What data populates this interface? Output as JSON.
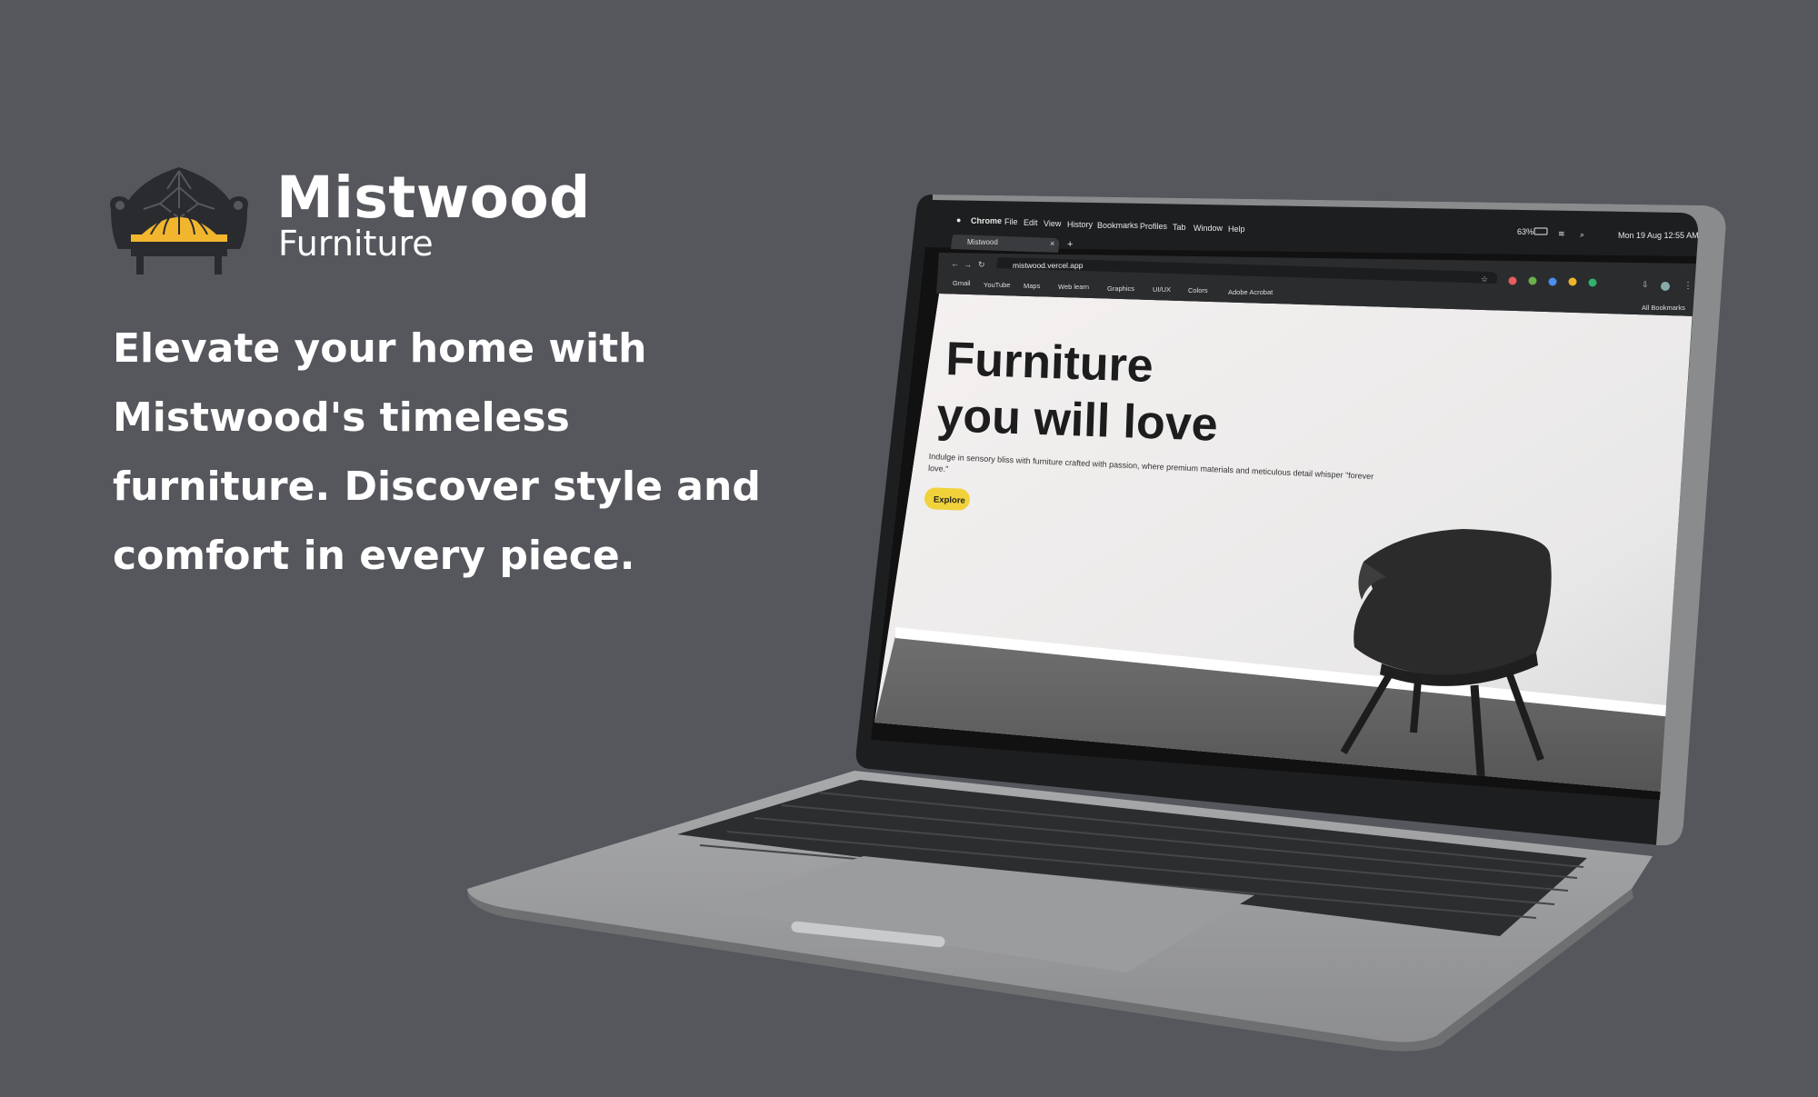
{
  "brand": {
    "name": "Mistwood",
    "subtitle": "Furniture"
  },
  "tagline": "Elevate your home with Mistwood's timeless furniture. Discover style and comfort in every piece.",
  "laptop": {
    "menubar": {
      "app": "Chrome",
      "items": [
        "File",
        "Edit",
        "View",
        "History",
        "Bookmarks",
        "Profiles",
        "Tab",
        "Window",
        "Help"
      ],
      "battery": "63%",
      "clock": "Mon 19 Aug  12:55 AM"
    },
    "browser": {
      "tab_title": "Mistwood",
      "url": "mistwood.vercel.app",
      "bookmarks": [
        "Gmail",
        "YouTube",
        "Maps",
        "Web learn",
        "Graphics",
        "UI/UX",
        "Colors",
        "Adobe Acrobat"
      ],
      "all_bookmarks": "All Bookmarks"
    },
    "page": {
      "headline_line1": "Furniture",
      "headline_line2": "you will love",
      "description": "Indulge in sensory bliss with furniture crafted with passion, where premium materials and meticulous detail whisper \"forever love.\"",
      "explore_button": "Explore"
    }
  },
  "colors": {
    "background": "#55575c",
    "accent": "#f2c63c",
    "text_light": "#ffffff"
  },
  "icons": [
    "armchair-logo-icon",
    "apple-icon",
    "wifi-icon",
    "battery-icon",
    "search-icon",
    "star-icon",
    "download-icon",
    "menu-dots-icon",
    "folder-icon"
  ]
}
